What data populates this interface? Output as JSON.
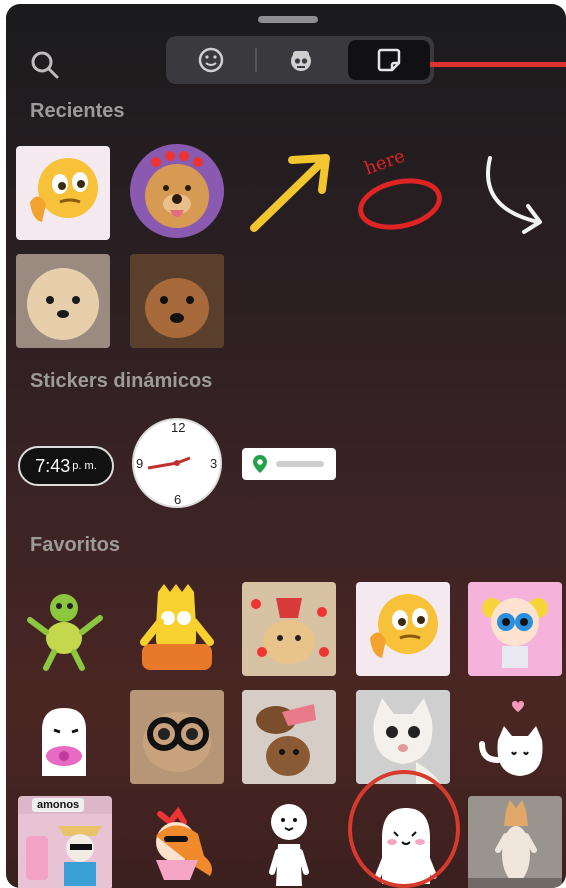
{
  "header": {
    "tabs": [
      {
        "icon": "smiley-face-icon",
        "active": false
      },
      {
        "icon": "avatar-face-icon",
        "active": false
      },
      {
        "icon": "sticker-icon",
        "active": true
      }
    ]
  },
  "sections": {
    "recent": "Recientes",
    "dynamic": "Stickers dinámicos",
    "favorites": "Favoritos"
  },
  "recent_stickers": [
    {
      "name": "thinking-emoji-sticker"
    },
    {
      "name": "dog-hearts-crown-sticker"
    },
    {
      "name": "yellow-arrow-sticker"
    },
    {
      "name": "here-circle-sticker",
      "text": "here"
    },
    {
      "name": "white-curved-arrow-sticker"
    },
    {
      "name": "fluffy-dog-photo-sticker"
    },
    {
      "name": "brown-dog-photo-sticker"
    }
  ],
  "dynamic_stickers": {
    "time": "7:43",
    "ampm": "p. m.",
    "analog_clock_numbers": [
      "12",
      "3",
      "6",
      "9"
    ]
  },
  "favorites": [
    {
      "name": "green-turtle-dance-sticker"
    },
    {
      "name": "bart-simpson-sticker"
    },
    {
      "name": "dog-hearts-hat-sticker"
    },
    {
      "name": "thinking-emoji-sticker-2"
    },
    {
      "name": "bubbles-powerpuff-sticker"
    },
    {
      "name": "blob-character-bow-sticker"
    },
    {
      "name": "dog-glasses-sticker"
    },
    {
      "name": "dogs-meme-sticker"
    },
    {
      "name": "cat-shocked-sticker"
    },
    {
      "name": "white-cat-heart-sticker"
    },
    {
      "name": "amonos-dog-sticker",
      "text": "amonos"
    },
    {
      "name": "blossom-powerpuff-sticker"
    },
    {
      "name": "stick-figure-sticker"
    },
    {
      "name": "white-blob-shy-sticker"
    },
    {
      "name": "standing-cat-sticker"
    }
  ],
  "colors": {
    "annotation_red": "#e03030"
  }
}
